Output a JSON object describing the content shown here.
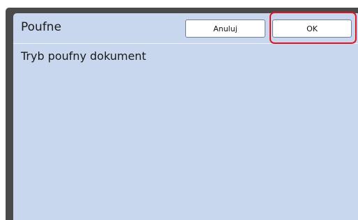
{
  "dialog": {
    "title": "Poufne",
    "cancel_label": "Anuluj",
    "ok_label": "OK",
    "message": "Tryb poufny dokument"
  },
  "colors": {
    "panel_background": "#c8d7ee",
    "frame": "#4a4a4a",
    "highlight": "#e0141e",
    "button_background": "#ffffff"
  }
}
